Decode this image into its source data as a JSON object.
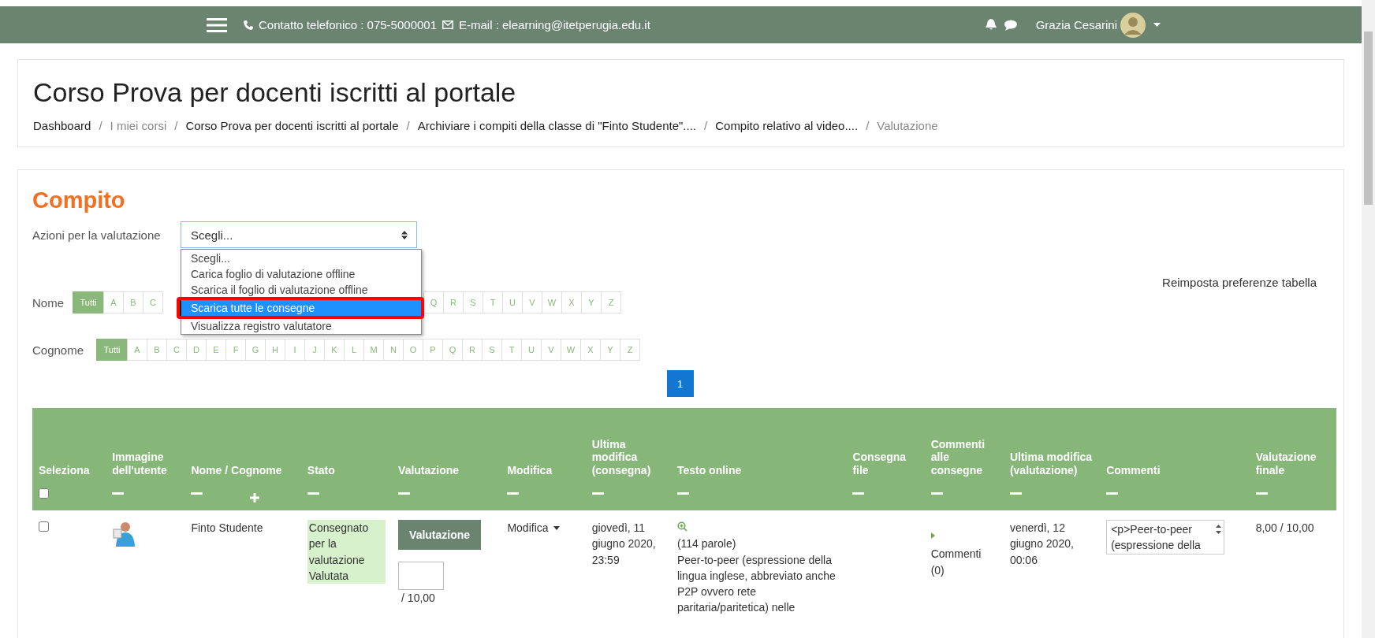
{
  "navbar": {
    "phone": "Contatto telefonico : 075-5000001",
    "email": "E-mail : elearning@itetperugia.edu.it",
    "user": "Grazia Cesarini"
  },
  "header": {
    "title": "Corso Prova per docenti iscritti al portale",
    "separator": "/",
    "breadcrumb": [
      {
        "label": "Dashboard",
        "muted": false
      },
      {
        "label": "I miei corsi",
        "muted": true
      },
      {
        "label": "Corso Prova per docenti iscritti al portale",
        "muted": false
      },
      {
        "label": "Archiviare i compiti della classe di \"Finto Studente\"....",
        "muted": false
      },
      {
        "label": "Compito relativo al video....",
        "muted": false
      },
      {
        "label": "Valutazione",
        "muted": true
      }
    ]
  },
  "page_title": "Compito",
  "actions": {
    "label": "Azioni per la valutazione",
    "value": "Scegli...",
    "options": [
      {
        "label": "Scegli...",
        "highlighted": false
      },
      {
        "label": "Carica foglio di valutazione offline",
        "highlighted": false
      },
      {
        "label": "Scarica il foglio di valutazione offline",
        "highlighted": false
      },
      {
        "label": "Scarica tutte le consegne",
        "highlighted": true
      },
      {
        "label": "Visualizza registro valutatore",
        "highlighted": false
      }
    ]
  },
  "reset_link": "Reimposta preferenze tabella",
  "filters": [
    {
      "label": "Nome",
      "letters": [
        {
          "label": "Tutti",
          "selected": true
        },
        {
          "label": "A",
          "selected": false
        },
        {
          "label": "B",
          "selected": false
        },
        {
          "label": "C",
          "selected": false
        },
        {
          "label": "Q",
          "selected": false
        },
        {
          "label": "R",
          "selected": false
        },
        {
          "label": "S",
          "selected": false
        },
        {
          "label": "T",
          "selected": false
        },
        {
          "label": "U",
          "selected": false
        },
        {
          "label": "V",
          "selected": false
        },
        {
          "label": "W",
          "selected": false
        },
        {
          "label": "X",
          "selected": false
        },
        {
          "label": "Y",
          "selected": false
        },
        {
          "label": "Z",
          "selected": false
        }
      ]
    },
    {
      "label": "Cognome",
      "letters": [
        {
          "label": "Tutti",
          "selected": true
        },
        {
          "label": "A",
          "selected": false
        },
        {
          "label": "B",
          "selected": false
        },
        {
          "label": "C",
          "selected": false
        },
        {
          "label": "D",
          "selected": false
        },
        {
          "label": "E",
          "selected": false
        },
        {
          "label": "F",
          "selected": false
        },
        {
          "label": "G",
          "selected": false
        },
        {
          "label": "H",
          "selected": false
        },
        {
          "label": "I",
          "selected": false
        },
        {
          "label": "J",
          "selected": false
        },
        {
          "label": "K",
          "selected": false
        },
        {
          "label": "L",
          "selected": false
        },
        {
          "label": "M",
          "selected": false
        },
        {
          "label": "N",
          "selected": false
        },
        {
          "label": "O",
          "selected": false
        },
        {
          "label": "P",
          "selected": false
        },
        {
          "label": "Q",
          "selected": false
        },
        {
          "label": "R",
          "selected": false
        },
        {
          "label": "S",
          "selected": false
        },
        {
          "label": "T",
          "selected": false
        },
        {
          "label": "U",
          "selected": false
        },
        {
          "label": "V",
          "selected": false
        },
        {
          "label": "W",
          "selected": false
        },
        {
          "label": "X",
          "selected": false
        },
        {
          "label": "Y",
          "selected": false
        },
        {
          "label": "Z",
          "selected": false
        }
      ]
    }
  ],
  "pagination": [
    {
      "label": "1",
      "selected": true
    }
  ],
  "table": {
    "select_all_checked": false,
    "columns": [
      "Seleziona",
      "Immagine dell'utente",
      "Nome / Cognome",
      "Stato",
      "Valutazione",
      "Modifica",
      "Ultima modifica (consegna)",
      "Testo online",
      "Consegna file",
      "Commenti alle consegne",
      "Ultima modifica (valutazione)",
      "Commenti",
      "Valutazione finale"
    ],
    "rows": [
      {
        "checked": false,
        "name": "Finto Studente",
        "status": "Consegnato per la valutazione",
        "grade_status": "Valutata",
        "grade_button": "Valutazione",
        "grade_max": "/ 10,00",
        "edit": "Modifica",
        "submitted": "giovedì, 11 giugno 2020, 23:59",
        "words": "(114 parole)",
        "online_text": "Peer-to-peer (espressione della lingua inglese, abbreviato anche P2P ovvero rete paritaria/paritetica) nelle",
        "comments_link": "Commenti (0)",
        "graded": "venerdì, 12 giugno 2020, 00:06",
        "feedback": "<p>Peer-to-peer (espressione della",
        "final_grade": "8,00 / 10,00"
      }
    ]
  }
}
